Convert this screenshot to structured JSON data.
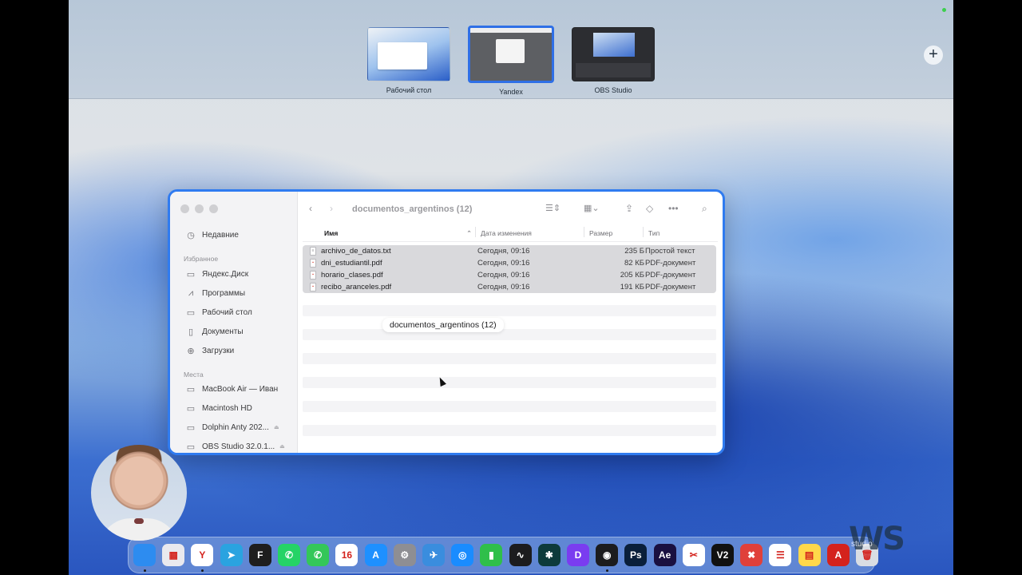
{
  "mission_control": {
    "spaces": [
      {
        "label": "Рабочий стол",
        "active": false
      },
      {
        "label": "Yandex",
        "active": true
      },
      {
        "label": "OBS Studio",
        "active": false
      }
    ],
    "add_space_glyph": "+"
  },
  "finder": {
    "title": "documentos_argentinos (12)",
    "sidebar": {
      "recent": "Недавние",
      "favorites_heading": "Избранное",
      "favorites": [
        "Яндекс.Диск",
        "Программы",
        "Рабочий стол",
        "Документы",
        "Загрузки"
      ],
      "places_heading": "Места",
      "places": [
        "MacBook Air — Иван",
        "Macintosh HD",
        "Dolphin Anty 202...",
        "OBS Studio 32.0.1..."
      ]
    },
    "columns": {
      "name": "Имя",
      "date": "Дата изменения",
      "size": "Размер",
      "kind": "Тип"
    },
    "files": [
      {
        "name": "archivo_de_datos.txt",
        "date": "Сегодня, 09:16",
        "size": "235 Б",
        "kind": "Простой текст",
        "icon": "text-file-icon"
      },
      {
        "name": "dni_estudiantil.pdf",
        "date": "Сегодня, 09:16",
        "size": "82 КБ",
        "kind": "PDF-документ",
        "icon": "pdf-file-icon"
      },
      {
        "name": "horario_clases.pdf",
        "date": "Сегодня, 09:16",
        "size": "205 КБ",
        "kind": "PDF-документ",
        "icon": "pdf-file-icon"
      },
      {
        "name": "recibo_aranceles.pdf",
        "date": "Сегодня, 09:16",
        "size": "191 КБ",
        "kind": "PDF-документ",
        "icon": "pdf-file-icon"
      }
    ],
    "drag_label": "documentos_argentinos (12)"
  },
  "dock": {
    "apps": [
      {
        "name": "Finder",
        "glyph": "",
        "color": "#2d8cf0"
      },
      {
        "name": "Launchpad",
        "glyph": "▦",
        "color": "#e9e9ee"
      },
      {
        "name": "Yandex",
        "glyph": "Y",
        "color": "#ffffff"
      },
      {
        "name": "Telegram",
        "glyph": "➤",
        "color": "#2aa3e0"
      },
      {
        "name": "Figma",
        "glyph": "F",
        "color": "#1e1e1e"
      },
      {
        "name": "WhatsApp",
        "glyph": "✆",
        "color": "#25d366"
      },
      {
        "name": "Phone",
        "glyph": "✆",
        "color": "#34c759"
      },
      {
        "name": "Calendar",
        "glyph": "16",
        "color": "#ffffff"
      },
      {
        "name": "App Store",
        "glyph": "A",
        "color": "#1e90ff"
      },
      {
        "name": "System Settings",
        "glyph": "⚙",
        "color": "#8e8e93"
      },
      {
        "name": "Mail",
        "glyph": "✈",
        "color": "#3a8dde"
      },
      {
        "name": "Safari",
        "glyph": "◎",
        "color": "#1a8cff"
      },
      {
        "name": "Numbers",
        "glyph": "▮",
        "color": "#2fbf4a"
      },
      {
        "name": "Activity Monitor",
        "glyph": "∿",
        "color": "#1c1c1e"
      },
      {
        "name": "Perplexity",
        "glyph": "✱",
        "color": "#0d3b3b"
      },
      {
        "name": "Dolphin",
        "glyph": "D",
        "color": "#7a3cf0"
      },
      {
        "name": "OBS Studio",
        "glyph": "◉",
        "color": "#1c1c1e"
      },
      {
        "name": "Photoshop",
        "glyph": "Ps",
        "color": "#0a1f3a"
      },
      {
        "name": "After Effects",
        "glyph": "Ae",
        "color": "#1a1040"
      },
      {
        "name": "CapCut",
        "glyph": "✂",
        "color": "#ffffff"
      },
      {
        "name": "V2",
        "glyph": "V2",
        "color": "#111111"
      },
      {
        "name": "Xmind",
        "glyph": "✖",
        "color": "#e0403a"
      },
      {
        "name": "Reminders",
        "glyph": "☰",
        "color": "#ffffff"
      },
      {
        "name": "Notes",
        "glyph": "▤",
        "color": "#ffd84a"
      },
      {
        "name": "Acrobat",
        "glyph": "A",
        "color": "#d4221c"
      },
      {
        "name": "Trash",
        "glyph": "🗑",
        "color": "#d9dde3"
      }
    ]
  },
  "watermark": {
    "text": "WS",
    "sub": "studio"
  }
}
